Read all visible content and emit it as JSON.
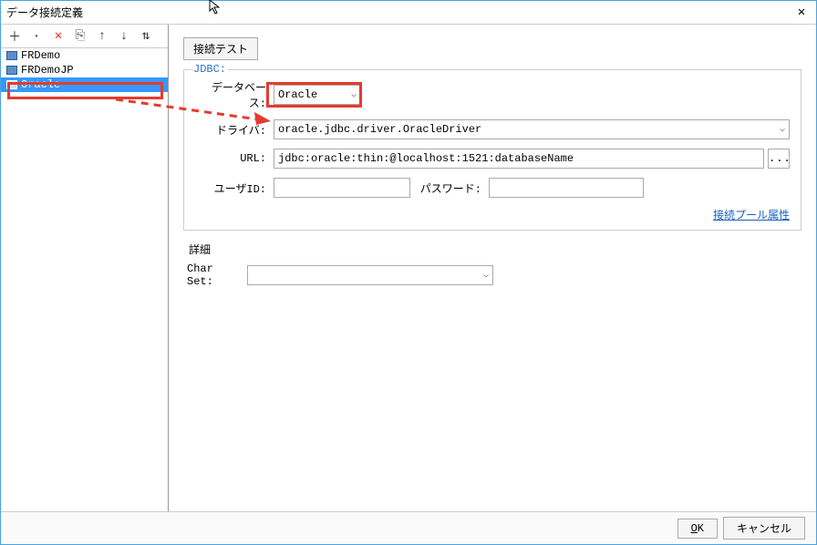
{
  "window": {
    "title": "データ接続定義"
  },
  "toolbar": {
    "add": "＋",
    "delete": "✕",
    "copy": "⎘",
    "up": "↑",
    "down": "↓",
    "sort": "⇅"
  },
  "list": {
    "items": [
      {
        "label": "FRDemo",
        "selected": false
      },
      {
        "label": "FRDemoJP",
        "selected": false
      },
      {
        "label": "Oracle",
        "selected": true
      }
    ]
  },
  "main": {
    "test_button": "接続テスト",
    "jdbc_legend": "JDBC:",
    "database_label": "データベース:",
    "database_value": "Oracle",
    "driver_label": "ドライバ:",
    "driver_value": "oracle.jdbc.driver.OracleDriver",
    "url_label": "URL:",
    "url_value": "jdbc:oracle:thin:@localhost:1521:databaseName",
    "ellipsis": "...",
    "user_label": "ユーザID:",
    "user_value": "",
    "password_label": "パスワード:",
    "password_value": "",
    "pool_link": "接続プール属性",
    "detail_header": "詳細",
    "charset_label": "Char Set:",
    "charset_value": ""
  },
  "footer": {
    "ok_prefix": "O",
    "ok_suffix": "K",
    "cancel": "キャンセル"
  }
}
